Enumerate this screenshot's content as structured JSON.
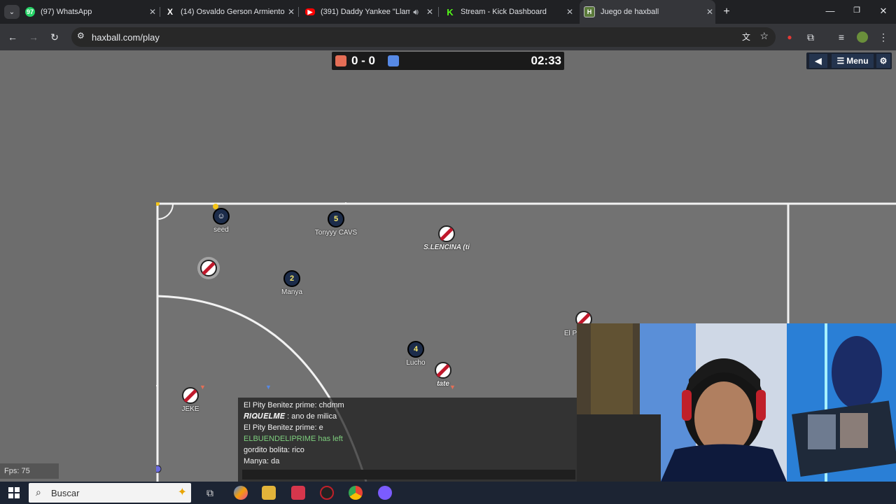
{
  "browser": {
    "tabs": [
      {
        "title": "(97) WhatsApp",
        "fav_text": "97",
        "fav_color": "#25d366",
        "active": false
      },
      {
        "title": "(14) Osvaldo Gerson Armiento",
        "fav_text": "X",
        "fav_color": "#000000",
        "active": false
      },
      {
        "title": "(391) Daddy Yankee \"Llamad",
        "fav_text": "",
        "fav_color": "#ff0000",
        "active": false
      },
      {
        "title": "Stream - Kick Dashboard",
        "fav_text": "K",
        "fav_color": "#53fc18",
        "active": false
      },
      {
        "title": "Juego de haxball",
        "fav_text": "H",
        "fav_color": "#5a7a3a",
        "active": true
      }
    ],
    "url": "haxball.com/play"
  },
  "game": {
    "score": "0 - 0",
    "timer": "02:33",
    "red_color": "#e56e56",
    "blue_color": "#5689e5",
    "menu_label": "Menu",
    "fps": "Fps: 75",
    "players": [
      {
        "name": "seed",
        "team": "blue",
        "number": ""
      },
      {
        "name": "Tonyyy CAVS",
        "team": "blue",
        "number": "5"
      },
      {
        "name": "S.LENCINA (ti",
        "team": "red",
        "number": ""
      },
      {
        "name": "",
        "team": "red",
        "number": ""
      },
      {
        "name": "Manya",
        "team": "blue",
        "number": "2"
      },
      {
        "name": "El P",
        "team": "red",
        "number": ""
      },
      {
        "name": "Lucho",
        "team": "blue",
        "number": "4"
      },
      {
        "name": "tate",
        "team": "red",
        "number": ""
      },
      {
        "name": "JEKE",
        "team": "red",
        "number": ""
      }
    ]
  },
  "chat": {
    "messages": [
      {
        "text": "El Pity Benitez prime: chdmm",
        "system": false
      },
      {
        "text": "𝑹𝑰𝑸𝑼𝑬𝑳𝑴𝑬 : ano de milica",
        "system": false
      },
      {
        "text": "El Pity Benitez prime: e",
        "system": false
      },
      {
        "text": "ELBUENDELIPRIME has left",
        "system": true
      },
      {
        "text": "gordito bolita: rico",
        "system": false
      },
      {
        "text": "Manya: da",
        "system": false
      }
    ]
  },
  "taskbar": {
    "search_label": "Buscar"
  }
}
